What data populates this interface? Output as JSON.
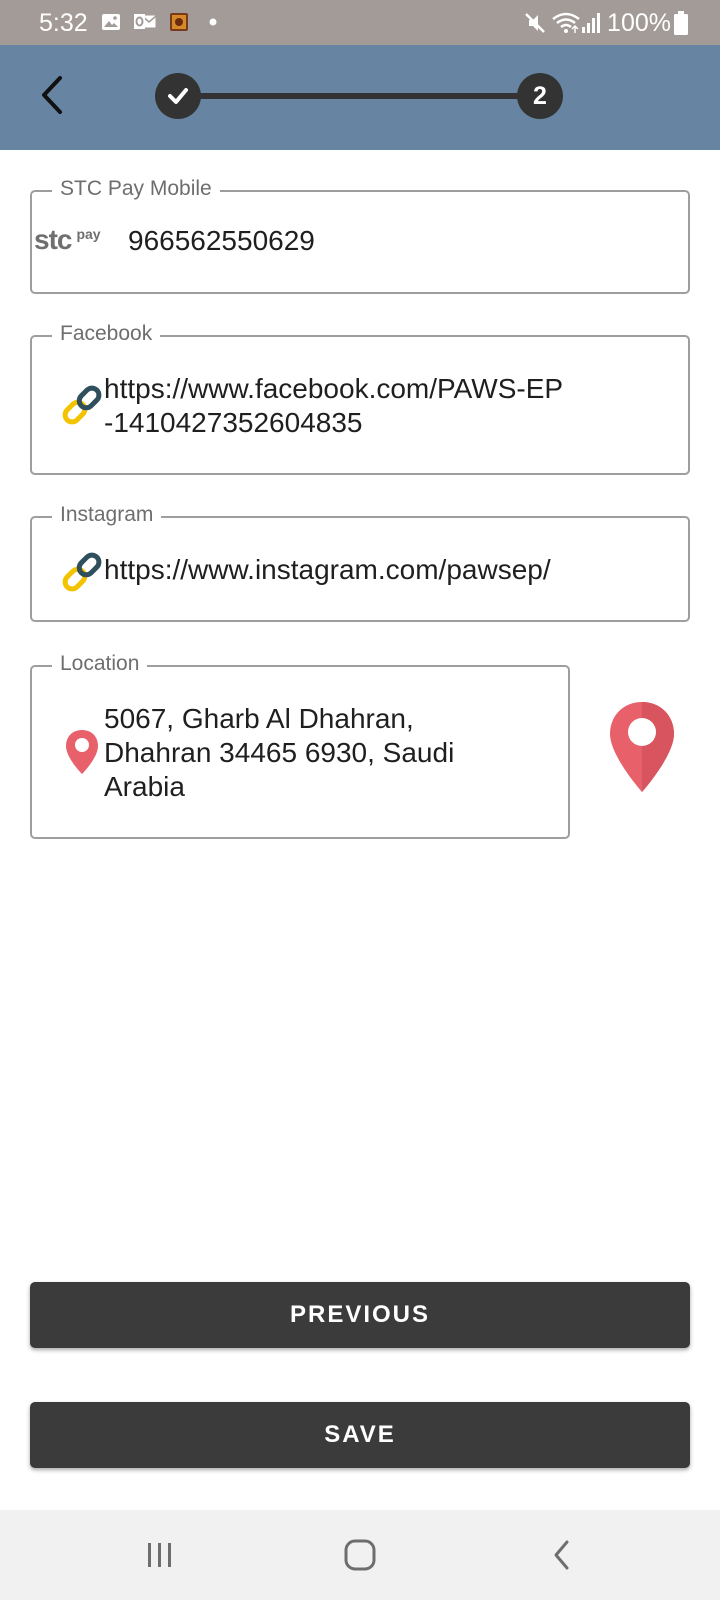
{
  "status_bar": {
    "time": "5:32",
    "battery": "100%",
    "notification_icons": [
      "gallery-icon",
      "outlook-icon",
      "game-icon",
      "dot-icon"
    ],
    "system_icons": [
      "mute-icon",
      "wifi-icon",
      "signal-icon",
      "battery-icon"
    ]
  },
  "stepper": {
    "completed_step_icon": "check-icon",
    "current_step": "2"
  },
  "fields": {
    "stc": {
      "label": "STC Pay Mobile",
      "logo_main": "stc",
      "logo_sub": "pay",
      "value": "966562550629"
    },
    "facebook": {
      "label": "Facebook",
      "value_line1": "https://www.facebook.com/PAWS-EP",
      "value_line2": "-1410427352604835"
    },
    "instagram": {
      "label": "Instagram",
      "value": "https://www.instagram.com/pawsep/"
    },
    "location": {
      "label": "Location",
      "value_line1": "5067, Gharb Al Dhahran,",
      "value_line2": "Dhahran 34465 6930, Saudi",
      "value_line3": "Arabia"
    }
  },
  "buttons": {
    "previous": "PREVIOUS",
    "save": "SAVE"
  },
  "colors": {
    "status_bar": "#a39b97",
    "app_bar": "#6785a2",
    "stepper": "#333333",
    "button": "#3b3b3b",
    "pin": "#e8616a",
    "nav_bar": "#f1f1f1"
  }
}
